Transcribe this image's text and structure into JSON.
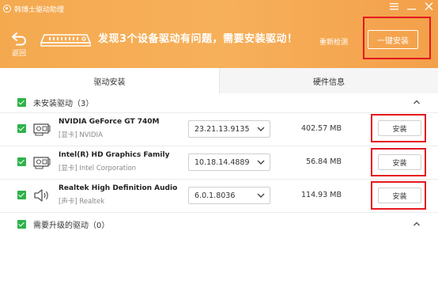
{
  "window": {
    "title": "韩博士驱动助理",
    "controls": [
      "menu-icon",
      "minimize-icon",
      "close-icon"
    ]
  },
  "header": {
    "back_label": "返回",
    "headline": "发现3个设备驱动有问题，需要安装驱动！",
    "recheck_label": "重新检测",
    "one_key_install_label": "一键安装",
    "accent_color": "#f4a94f",
    "highlight_color": "#e5181f"
  },
  "tabs": [
    {
      "label": "驱动安装",
      "active": true
    },
    {
      "label": "硬件信息",
      "active": false
    }
  ],
  "sections": {
    "uninstalled": {
      "label": "未安装驱动（3）",
      "checked": true,
      "expanded": true
    },
    "upgrade": {
      "label": "需要升级的驱动（0）",
      "checked": true,
      "expanded": true
    }
  },
  "drivers": [
    {
      "name": "NVIDIA GeForce GT 740M",
      "category": "[显卡] NVIDIA",
      "version": "23.21.13.9135",
      "size": "402.57 MB",
      "action": "安装",
      "icon": "graphics-card-icon",
      "checked": true
    },
    {
      "name": "Intel(R) HD Graphics Family",
      "category": "[显卡] Intel Corporation",
      "version": "10.18.14.4889",
      "size": "56.84 MB",
      "action": "安装",
      "icon": "graphics-card-icon",
      "checked": true
    },
    {
      "name": "Realtek High Definition Audio",
      "category": "[声卡] Realtek",
      "version": "6.0.1.8036",
      "size": "114.93 MB",
      "action": "安装",
      "icon": "speaker-icon",
      "checked": true
    }
  ]
}
